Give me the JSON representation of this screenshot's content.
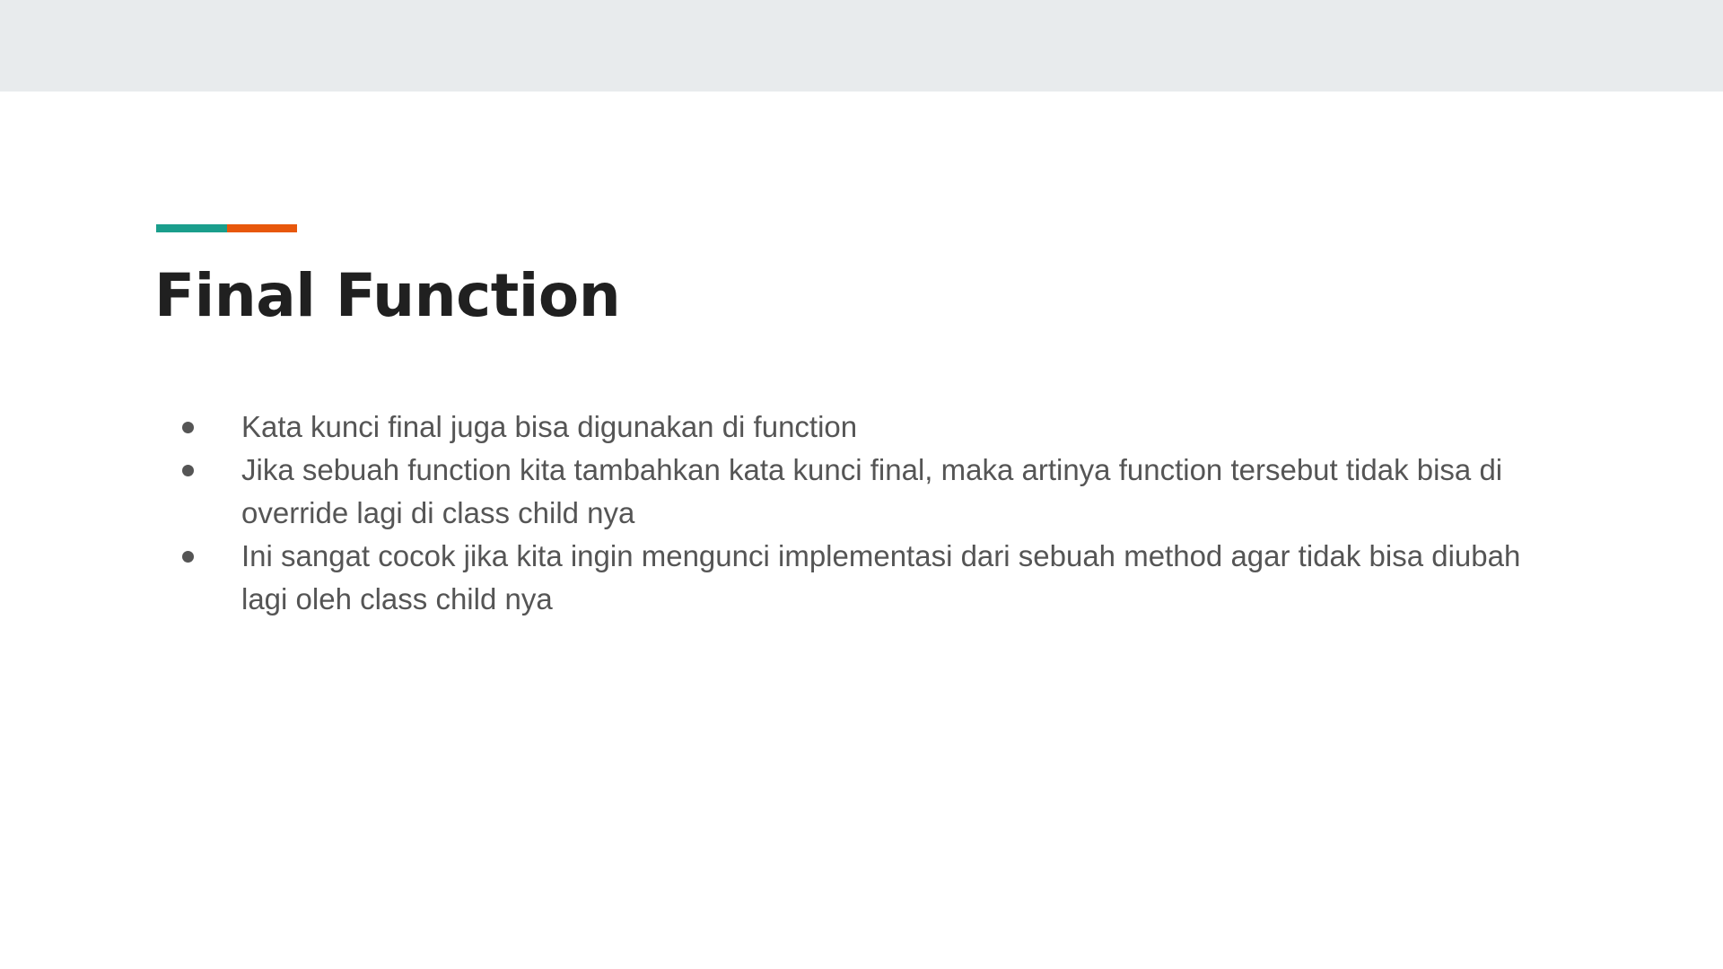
{
  "slide": {
    "title": "Final Function",
    "accent_colors": {
      "teal": "#1a9e8c",
      "orange": "#e8580c"
    },
    "bullets": [
      "Kata kunci final juga bisa digunakan di function",
      "Jika sebuah function kita tambahkan kata kunci final, maka artinya function tersebut tidak bisa di override lagi di class child nya",
      "Ini sangat cocok jika kita ingin mengunci implementasi dari sebuah method agar tidak bisa diubah lagi oleh class child nya"
    ]
  }
}
